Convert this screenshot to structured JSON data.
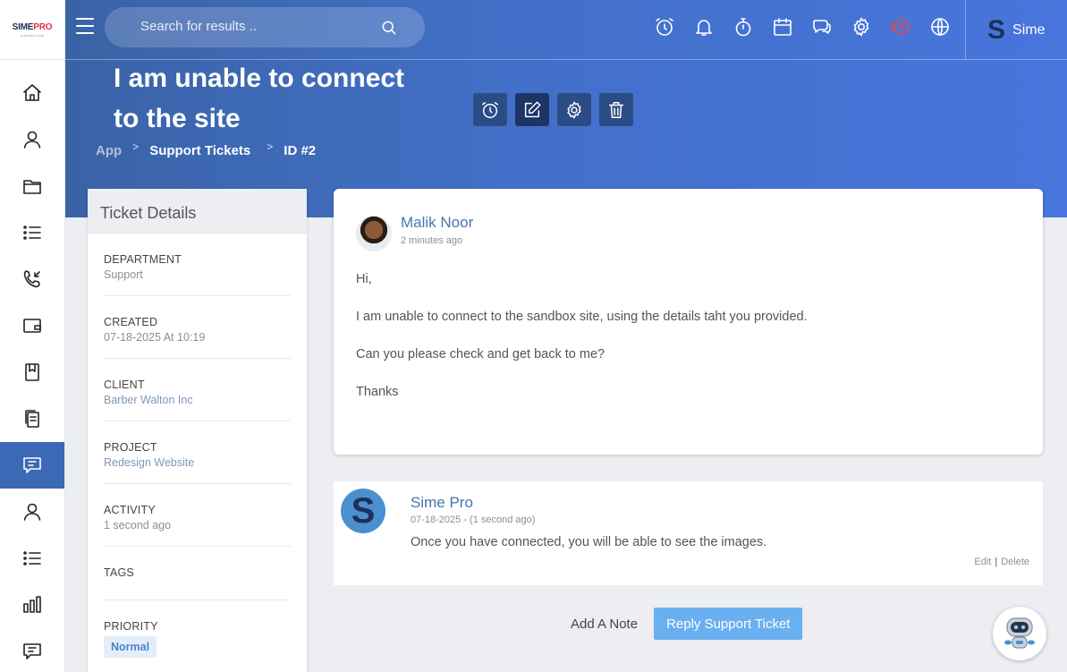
{
  "brand": {
    "logo_main": "SIME",
    "logo_accent": "PRO",
    "logo_sub": "a simepro.com"
  },
  "search": {
    "placeholder": "Search for results .."
  },
  "user": {
    "initial": "S",
    "name": "Sime"
  },
  "ticket": {
    "title": "I am unable to connect to the site"
  },
  "breadcrumb": {
    "app": "App",
    "section": "Support Tickets",
    "id": "ID #2"
  },
  "details": {
    "header": "Ticket Details",
    "department": {
      "label": "DEPARTMENT",
      "value": "Support"
    },
    "created": {
      "label": "CREATED",
      "value": "07-18-2025 At 10:19"
    },
    "client": {
      "label": "CLIENT",
      "value": "Barber Walton Inc"
    },
    "project": {
      "label": "PROJECT",
      "value": "Redesign Website"
    },
    "activity": {
      "label": "ACTIVITY",
      "value": "1 second ago"
    },
    "tags": {
      "label": "TAGS"
    },
    "priority": {
      "label": "PRIORITY",
      "value": "Normal"
    }
  },
  "message": {
    "author": "Malik Noor",
    "time": "2 minutes ago",
    "lines": [
      "Hi,",
      "I am unable to connect to the sandbox site, using the details taht you provided.",
      "Can you please check and get back to me?",
      "Thanks"
    ]
  },
  "note": {
    "avatar_initial": "S",
    "author": "Sime Pro",
    "time": "07-18-2025 - (1 second ago)",
    "text": "Once you have connected, you will be able to see the images.",
    "edit_label": "Edit",
    "delete_label": "Delete"
  },
  "buttons": {
    "add_note": "Add A Note",
    "reply": "Reply Support Ticket"
  },
  "colors": {
    "header": "#4270c8",
    "active_nav": "#3b69b5",
    "priority_badge": "#e4eefb",
    "reply_button": "#6aaff0"
  }
}
